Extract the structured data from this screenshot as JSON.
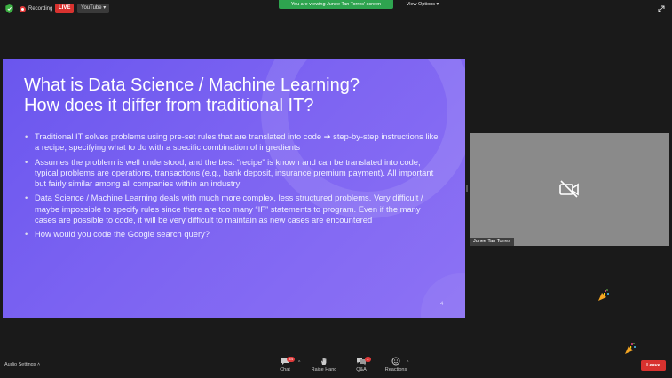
{
  "topbar": {
    "recording_label": "Recording",
    "live_label": "LIVE",
    "youtube_label": "YouTube ▾",
    "viewing_banner": "You are viewing Junee Tan Torres' screen",
    "view_options_label": "View Options ▾"
  },
  "slide": {
    "title_line1": "What is Data Science / Machine Learning?",
    "title_line2": "How does it differ from traditional IT?",
    "bullets": [
      "Traditional IT solves problems using pre-set rules that are translated into code ➔ step-by-step instructions like a recipe, specifying what to do with a specific combination of ingredients",
      "Assumes the problem is well understood, and the best “recipe” is known and can be translated into code; typical problems are operations, transactions (e.g., bank deposit, insurance premium payment).  All important but fairly similar among all companies within an industry",
      "Data Science / Machine Learning deals with much more complex, less structured problems.  Very difficult  / maybe impossible to specify rules since there are too many “IF” statements to program.  Even if the many cases are possible to code, it will be very difficult to maintain as new cases are encountered",
      "How would you code the Google search query?"
    ],
    "slide_number": "4"
  },
  "participant": {
    "name": "Junee Tan Torres"
  },
  "toolbar": {
    "audio_settings_label": "Audio Settings ˄",
    "chat_label": "Chat",
    "chat_badge": "84",
    "raise_hand_label": "Raise Hand",
    "qa_label": "Q&A",
    "qa_badge": "1",
    "reactions_label": "Reactions",
    "leave_label": "Leave"
  },
  "colors": {
    "slide_accent": "#7c63f2",
    "viewing_banner_bg": "#2ea44f",
    "leave_bg": "#d8322f",
    "live_bg": "#d8322f"
  },
  "icons": [
    "shield-icon",
    "record-icon",
    "fullscreen-icon",
    "video-off-icon",
    "confetti-icon",
    "chat-icon",
    "hand-icon",
    "qa-icon",
    "reactions-icon"
  ]
}
